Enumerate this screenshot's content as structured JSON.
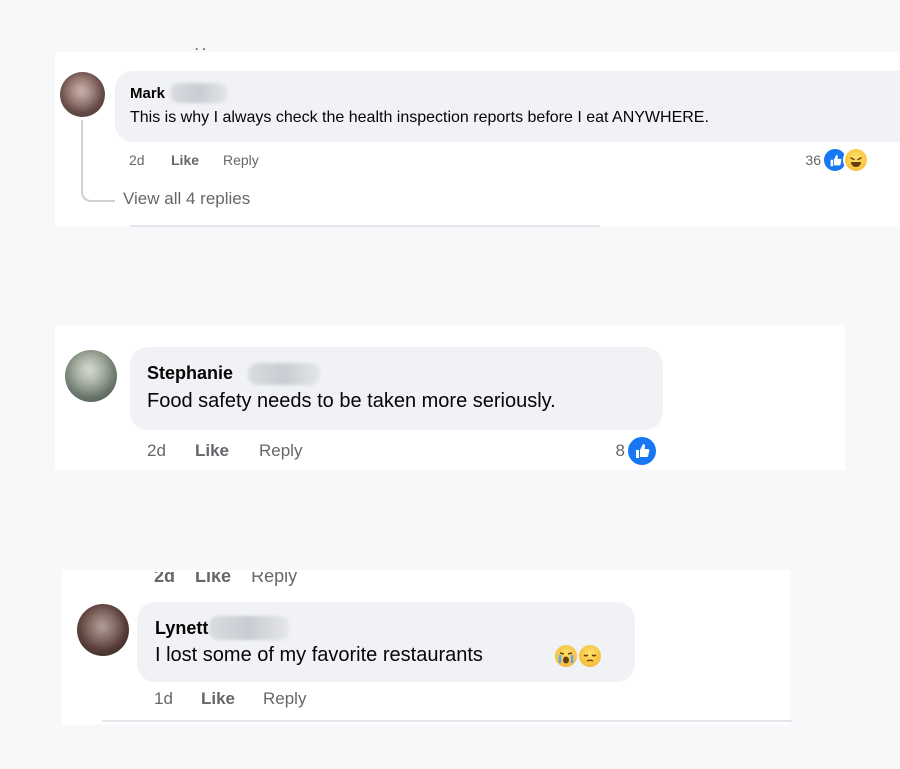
{
  "comments": [
    {
      "author": "Mark",
      "text": "This is why I always check the health inspection reports before I eat ANYWHERE.",
      "time": "2d",
      "like_label": "Like",
      "reply_label": "Reply",
      "reaction_count": "36",
      "reactions": [
        "like-icon",
        "haha-icon"
      ],
      "view_replies": "View all 4 replies"
    },
    {
      "author": "Stephanie",
      "text": "Food safety needs to be taken more seriously.",
      "time": "2d",
      "like_label": "Like",
      "reply_label": "Reply",
      "reaction_count": "8",
      "reactions": [
        "like-icon"
      ]
    },
    {
      "author": "Lynett",
      "text": "I lost some of my favorite restaurants",
      "text_emojis": [
        "crying-face-emoji",
        "pensive-face-emoji"
      ],
      "time": "1d",
      "like_label": "Like",
      "reply_label": "Reply",
      "above_cutoff": {
        "time": "2d",
        "like": "Like",
        "reply": "Reply"
      }
    }
  ],
  "colors": {
    "bubble": "#f0f2f5",
    "meta_text": "#65676b",
    "like_blue": "#1877f2"
  }
}
